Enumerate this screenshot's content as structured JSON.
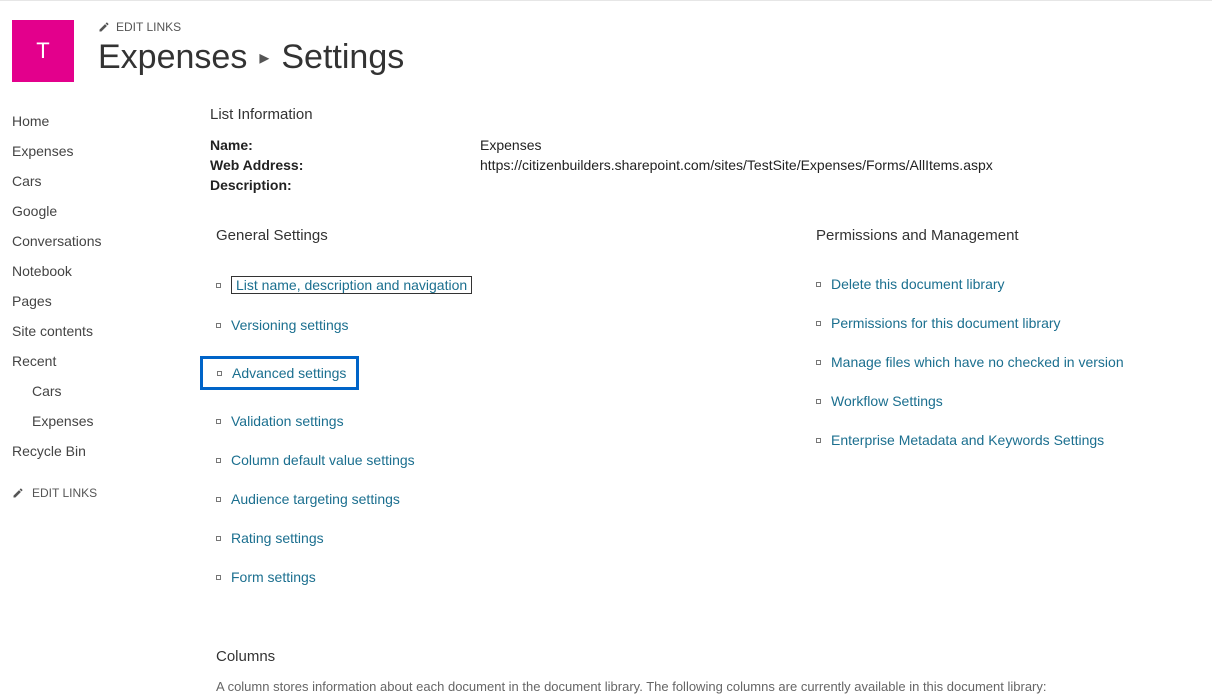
{
  "site": {
    "tile_letter": "T",
    "edit_links_label": "EDIT LINKS"
  },
  "breadcrumb": {
    "parent": "Expenses",
    "current": "Settings"
  },
  "nav": {
    "items": [
      "Home",
      "Expenses",
      "Cars",
      "Google",
      "Conversations",
      "Notebook",
      "Pages",
      "Site contents"
    ],
    "recent_label": "Recent",
    "recent_items": [
      "Cars",
      "Expenses"
    ],
    "recycle_bin": "Recycle Bin",
    "edit_links_label": "EDIT LINKS"
  },
  "list_info": {
    "section_title": "List Information",
    "name_label": "Name:",
    "name_value": "Expenses",
    "web_address_label": "Web Address:",
    "web_address_value": "https://citizenbuilders.sharepoint.com/sites/TestSite/Expenses/Forms/AllItems.aspx",
    "description_label": "Description:"
  },
  "general_settings": {
    "title": "General Settings",
    "items": [
      "List name, description and navigation",
      "Versioning settings",
      "Advanced settings",
      "Validation settings",
      "Column default value settings",
      "Audience targeting settings",
      "Rating settings",
      "Form settings"
    ]
  },
  "permissions": {
    "title": "Permissions and Management",
    "items": [
      "Delete this document library",
      "Permissions for this document library",
      "Manage files which have no checked in version",
      "Workflow Settings",
      "Enterprise Metadata and Keywords Settings"
    ]
  },
  "columns": {
    "title": "Columns",
    "desc": "A column stores information about each document in the document library. The following columns are currently available in this document library:"
  }
}
